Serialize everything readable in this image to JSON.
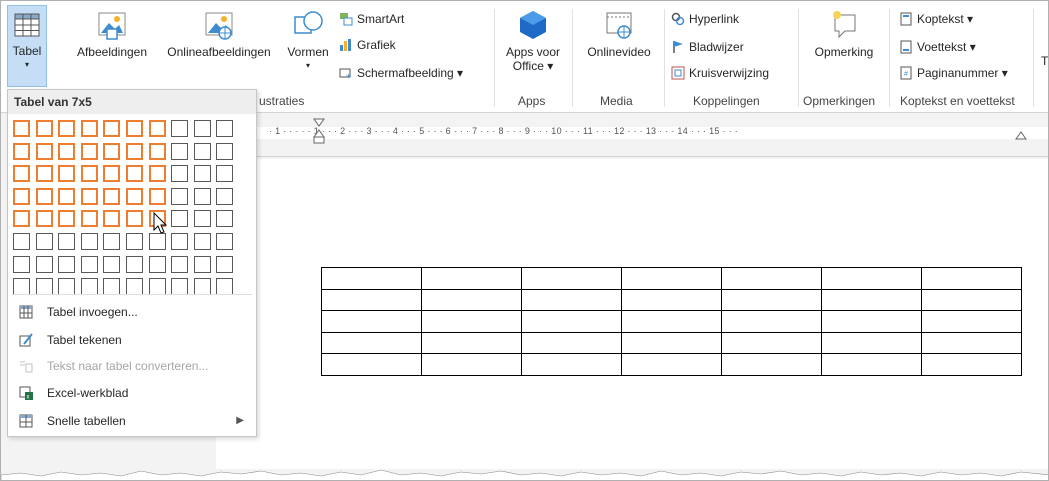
{
  "ribbon": {
    "tabel": {
      "label": "Tabel"
    },
    "afbeeldingen": {
      "label": "Afbeeldingen"
    },
    "onlineafbeeldingen": {
      "label": "Onlineafbeeldingen"
    },
    "vormen": {
      "label": "Vormen"
    },
    "smartart": {
      "label": "SmartArt"
    },
    "grafiek": {
      "label": "Grafiek"
    },
    "schermafbeelding": {
      "label": "Schermafbeelding ▾"
    },
    "apps_voor_office": {
      "line1": "Apps voor",
      "line2": "Office ▾"
    },
    "onlinevideo": {
      "label": "Onlinevideo"
    },
    "hyperlink": {
      "label": "Hyperlink"
    },
    "bladwijzer": {
      "label": "Bladwijzer"
    },
    "kruisverwijzing": {
      "label": "Kruisverwijzing"
    },
    "opmerking": {
      "label": "Opmerking"
    },
    "koptekst": {
      "label": "Koptekst ▾"
    },
    "voettekst": {
      "label": "Voettekst ▾"
    },
    "paginanummer": {
      "label": "Paginanummer ▾"
    },
    "groups": {
      "illustraties": "ustraties",
      "apps": "Apps",
      "media": "Media",
      "koppelingen": "Koppelingen",
      "opmerkingen": "Opmerkingen",
      "koptekst_voettekst": "Koptekst en voettekst"
    },
    "cut_off_label": "T",
    "accent_selected_bg": "#c5def5"
  },
  "ruler": {
    "text": "· 1 · · · · · 1 · · · 2 · · · 3 · · · 4 · · · 5 · · · 6 · · · 7 · · · 8 · · · 9 · · · 10 · · · 11 · · · 12 · · · 13 · · · 14 · · · 15 · · ·"
  },
  "dropdown": {
    "title": "Tabel van 7x5",
    "grid": {
      "cols": 10,
      "rows": 8,
      "selected_cols": 7,
      "selected_rows": 5
    },
    "selection_color": "#ed7d31",
    "items": [
      {
        "label": "Tabel invoegen...",
        "icon": "table-icon",
        "enabled": true
      },
      {
        "label": "Tabel tekenen",
        "icon": "pencil-table-icon",
        "enabled": true
      },
      {
        "label": "Tekst naar tabel converteren...",
        "icon": "convert-icon",
        "enabled": false
      },
      {
        "label": "Excel-werkblad",
        "icon": "excel-icon",
        "enabled": true
      },
      {
        "label": "Snelle tabellen",
        "icon": "quick-tables-icon",
        "enabled": true,
        "submenu": true
      }
    ]
  },
  "document": {
    "table": {
      "cols": 7,
      "rows": 5
    }
  }
}
